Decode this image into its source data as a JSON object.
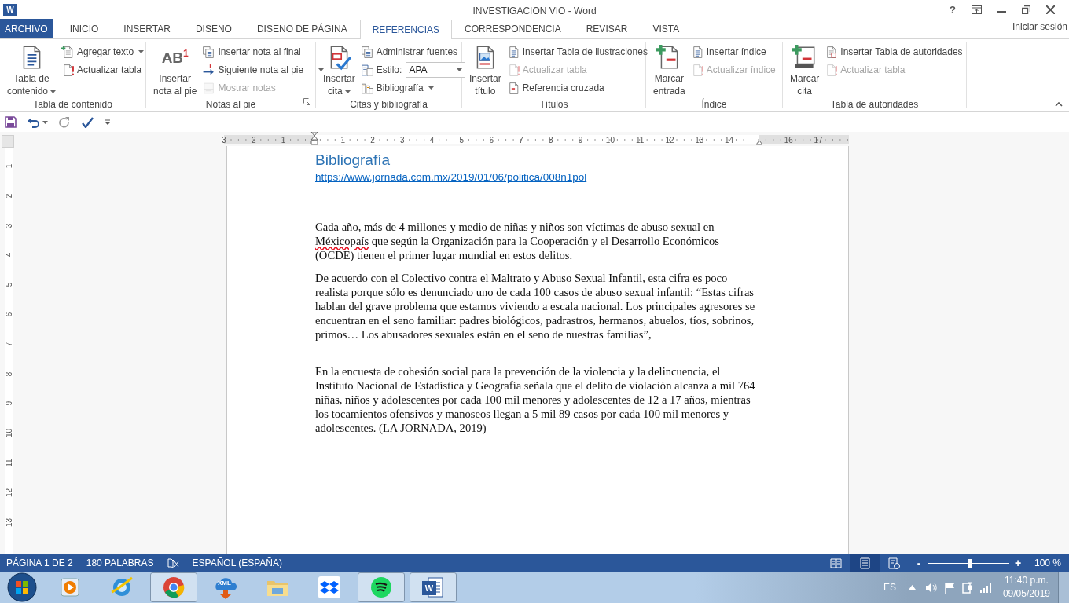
{
  "window": {
    "title": "INVESTIGACION VIO - Word",
    "app_badge": "W",
    "help": "?"
  },
  "tabs": [
    {
      "label": "ARCHIVO",
      "kind": "file",
      "selected": false
    },
    {
      "label": "INICIO",
      "kind": "tab",
      "selected": false
    },
    {
      "label": "INSERTAR",
      "kind": "tab",
      "selected": false
    },
    {
      "label": "DISEÑO",
      "kind": "tab",
      "selected": false
    },
    {
      "label": "DISEÑO DE PÁGINA",
      "kind": "tab",
      "selected": false
    },
    {
      "label": "REFERENCIAS",
      "kind": "tab",
      "selected": true
    },
    {
      "label": "CORRESPONDENCIA",
      "kind": "tab",
      "selected": false
    },
    {
      "label": "REVISAR",
      "kind": "tab",
      "selected": false
    },
    {
      "label": "VISTA",
      "kind": "tab",
      "selected": false
    }
  ],
  "account": "Iniciar sesión",
  "ribbon": {
    "groups": [
      {
        "label": "Tabla de contenido",
        "items": [
          {
            "kind": "large",
            "label": "Tabla de\ncontenido",
            "dropdown": true,
            "disabled": false
          },
          {
            "kind": "small",
            "label": "Agregar texto",
            "dropdown": true,
            "disabled": false
          },
          {
            "kind": "small",
            "label": "Actualizar tabla",
            "disabled": false
          }
        ]
      },
      {
        "label": "Notas al pie",
        "launcher": true,
        "items": [
          {
            "kind": "large",
            "glyph": "AB$^{1}$",
            "label": "Insertar\nnota al pie",
            "disabled": false
          },
          {
            "kind": "small",
            "label": "Insertar nota al final",
            "disabled": false
          },
          {
            "kind": "small",
            "label": "Siguiente nota al pie",
            "dropdown": true,
            "disabled": false
          },
          {
            "kind": "small",
            "label": "Mostrar notas",
            "disabled": true
          }
        ]
      },
      {
        "label": "Citas y bibliografía",
        "items": [
          {
            "kind": "large",
            "label": "Insertar\ncita",
            "dropdown": true,
            "disabled": false
          },
          {
            "kind": "small",
            "label": "Administrar fuentes",
            "disabled": false
          },
          {
            "kind": "combo",
            "label": "Estilo:",
            "value": "APA",
            "dropdown": true,
            "disabled": false
          },
          {
            "kind": "small",
            "label": "Bibliografía",
            "dropdown": true,
            "disabled": false
          }
        ]
      },
      {
        "label": "Títulos",
        "items": [
          {
            "kind": "large",
            "label": "Insertar\ntítulo",
            "disabled": false
          },
          {
            "kind": "small",
            "label": "Insertar Tabla de ilustraciones",
            "disabled": false
          },
          {
            "kind": "small",
            "label": "Actualizar tabla",
            "disabled": true
          },
          {
            "kind": "small",
            "label": "Referencia cruzada",
            "disabled": false
          }
        ]
      },
      {
        "label": "Índice",
        "items": [
          {
            "kind": "large",
            "label": "Marcar\nentrada",
            "disabled": false
          },
          {
            "kind": "small",
            "label": "Insertar índice",
            "disabled": false
          },
          {
            "kind": "small",
            "label": "Actualizar índice",
            "disabled": true
          }
        ]
      },
      {
        "label": "Tabla de autoridades",
        "items": [
          {
            "kind": "large",
            "label": "Marcar\ncita",
            "disabled": false
          },
          {
            "kind": "small",
            "label": "Insertar Tabla de autoridades",
            "disabled": false
          },
          {
            "kind": "small",
            "label": "Actualizar tabla",
            "disabled": true
          }
        ]
      }
    ]
  },
  "ruler": {
    "horizontal": [
      "3",
      "2",
      "1",
      "1",
      "2",
      "3",
      "4",
      "5",
      "6",
      "7",
      "8",
      "9",
      "10",
      "11",
      "12",
      "13",
      "14",
      "16",
      "17"
    ],
    "vertical": [
      "1",
      "2",
      "3",
      "4",
      "5",
      "6",
      "7",
      "8",
      "9",
      "10",
      "11",
      "12",
      "13"
    ]
  },
  "document": {
    "paragraphs": [
      {
        "kind": "heading",
        "text": "Bibliografía"
      },
      {
        "kind": "link",
        "text": "https://www.jornada.com.mx/2019/01/06/politica/008n1pol"
      },
      {
        "kind": "body",
        "segments": [
          {
            "text": "Cada año, más de 4 millones y medio de niñas y niños son víctimas de abuso sexual en ",
            "misspelled": false
          },
          {
            "text": "Méxicopaís",
            "misspelled": true
          },
          {
            "text": " que según la Organización para la Cooperación y el Desarrollo Económicos (OCDE) tienen el primer lugar mundial en estos delitos.",
            "misspelled": false
          }
        ]
      },
      {
        "kind": "body",
        "segments": [
          {
            "text": "De acuerdo con el Colectivo contra el Maltrato y Abuso Sexual Infantil, esta cifra es poco realista porque sólo es denunciado uno de cada 100 casos de abuso sexual infantil: “Estas cifras hablan del grave problema que estamos viviendo a escala nacional. Los principales agresores se encuentran en el seno familiar: padres biológicos, padrastros, hermanos, abuelos, tíos, sobrinos, primos… Los abusadores sexuales están en el seno de nuestras familias”,",
            "misspelled": false
          }
        ]
      },
      {
        "kind": "body",
        "segments": [
          {
            "text": "En la encuesta de cohesión social para la prevención de la violencia y la delincuencia, el Instituto Nacional de Estadística y Geografía señala que el delito de violación alcanza a mil 764 niñas, niños y adolescentes por cada 100 mil menores y adolescentes de 12 a 17 años, mientras los tocamientos ofensivos y manoseos llegan a 5 mil 89 casos por cada 100 mil menores y adolescentes. (LA JORNADA, 2019)",
            "misspelled": false
          }
        ]
      }
    ]
  },
  "status_bar": {
    "page": "PÁGINA 1 DE 2",
    "words": "180 PALABRAS",
    "language": "ESPAÑOL (ESPAÑA)",
    "views": [
      {
        "selected": false
      },
      {
        "selected": true
      },
      {
        "selected": false
      }
    ],
    "zoom_out": "-",
    "zoom_in": "+",
    "zoom": {
      "level": 0.52
    },
    "zoom_label": "100 %"
  },
  "taskbar": {
    "apps": [
      {
        "open": false
      },
      {
        "open": false
      },
      {
        "open": true
      },
      {
        "open": false,
        "badge": "XML"
      },
      {
        "open": false
      },
      {
        "open": false
      },
      {
        "open": true
      },
      {
        "open": true,
        "badge": "W"
      }
    ],
    "tray": {
      "language": "ES",
      "time": "11:40 p.m.",
      "date": "09/05/2019"
    }
  }
}
